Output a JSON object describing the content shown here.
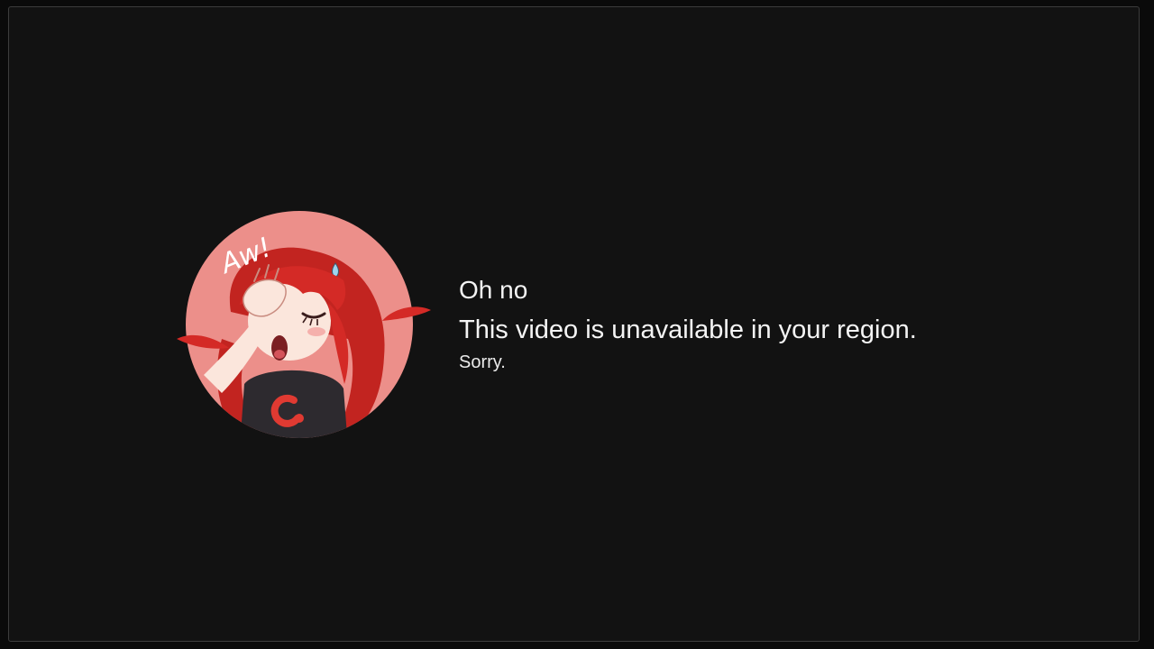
{
  "error": {
    "title": "Oh no",
    "headline": "This video is unavailable in your region.",
    "subtext": "Sorry."
  },
  "mascot": {
    "icon": "facepalm-mascot-icon",
    "caption": "Aw!",
    "shirt_logo": "brand-c-logo-icon"
  },
  "colors": {
    "background": "#121212",
    "frame_border": "#3c3c3c",
    "text": "#f4f4f4",
    "badge_circle": "#ec8f8a",
    "hair": "#d42a26",
    "shirt": "#2d2a2f",
    "logo_red": "#e03a32"
  }
}
